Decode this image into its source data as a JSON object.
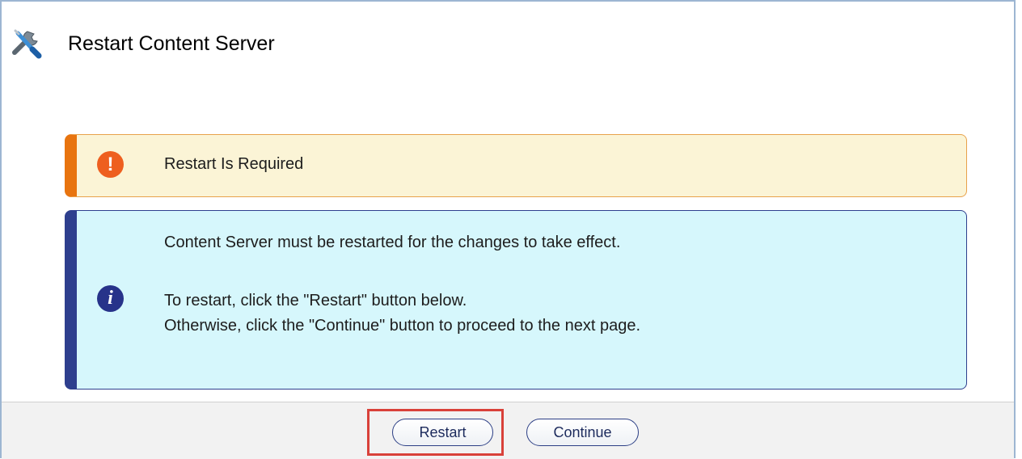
{
  "page": {
    "title": "Restart Content Server",
    "icon": "tools-icon"
  },
  "warning": {
    "icon": "exclamation-icon",
    "badge_glyph": "!",
    "text": "Restart Is Required",
    "accent_color": "#e8740f"
  },
  "info": {
    "icon": "info-icon",
    "badge_glyph": "i",
    "line1": "Content Server must be restarted for the changes to take effect.",
    "line2": "To restart, click the \"Restart\" button below.",
    "line3": "Otherwise, click the \"Continue\" button to proceed to the next page.",
    "accent_color": "#2e3f8e"
  },
  "footer": {
    "restart_label": "Restart",
    "continue_label": "Continue",
    "highlight_color": "#d9413a"
  }
}
